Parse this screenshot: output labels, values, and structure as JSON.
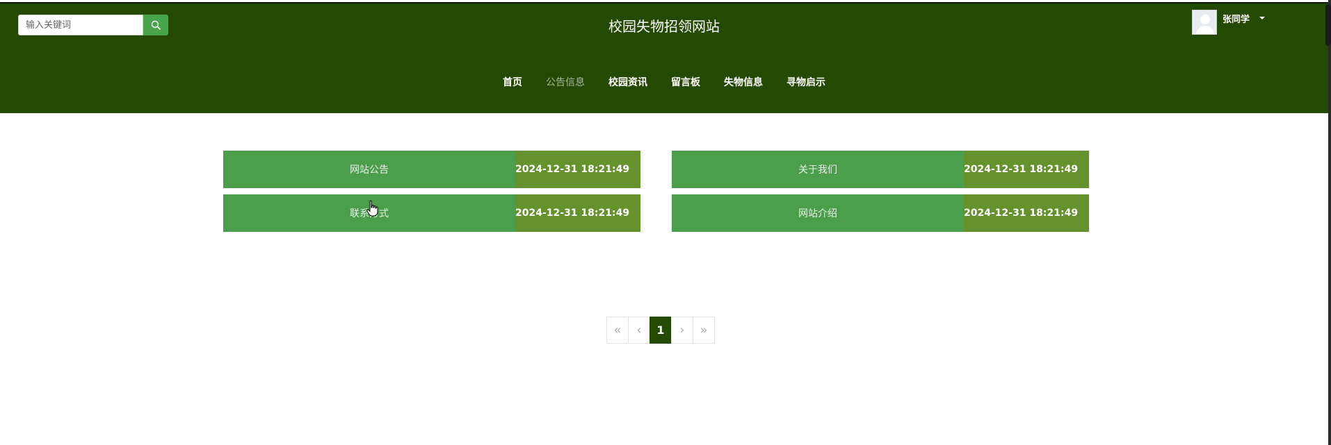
{
  "header": {
    "site_title": "校园失物招领网站",
    "search_placeholder": "输入关键词",
    "user_name": "张同学"
  },
  "nav": [
    {
      "label": "首页",
      "active": false
    },
    {
      "label": "公告信息",
      "active": true
    },
    {
      "label": "校园资讯",
      "active": false
    },
    {
      "label": "留言板",
      "active": false
    },
    {
      "label": "失物信息",
      "active": false
    },
    {
      "label": "寻物启示",
      "active": false
    }
  ],
  "cards": [
    {
      "title": "网站公告",
      "date": "2024-12-31 18:21:49"
    },
    {
      "title": "关于我们",
      "date": "2024-12-31 18:21:49"
    },
    {
      "title": "联系方式",
      "date": "2024-12-31 18:21:49"
    },
    {
      "title": "网站介绍",
      "date": "2024-12-31 18:21:49"
    }
  ],
  "pagination": {
    "first": "«",
    "prev": "‹",
    "current": "1",
    "next": "›",
    "last": "»"
  },
  "colors": {
    "header_bg": "#244a02",
    "card_title_bg": "#4a9e4c",
    "card_date_bg": "#66922e",
    "search_button": "#4aa44a"
  },
  "icons": {
    "search": "search-icon",
    "avatar": "avatar-placeholder",
    "dropdown": "caret-down-icon",
    "cursor": "hand-pointer-icon"
  }
}
